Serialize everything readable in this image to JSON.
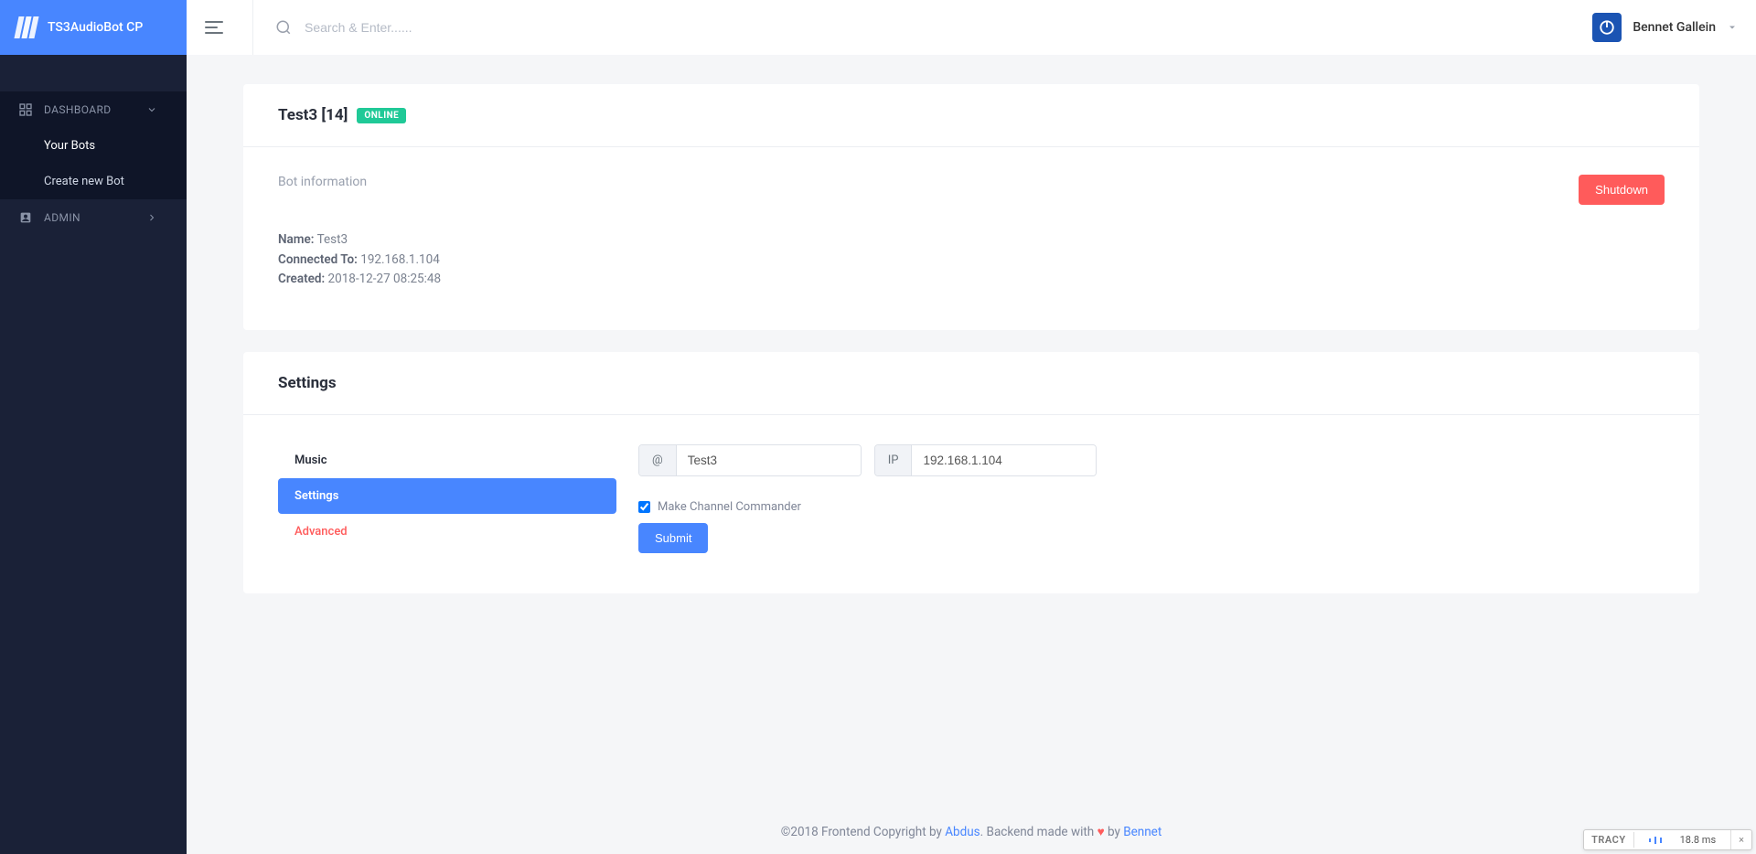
{
  "brand": {
    "title": "TS3AudioBot CP"
  },
  "search": {
    "placeholder": "Search & Enter......"
  },
  "user": {
    "name": "Bennet Gallein"
  },
  "sidebar": {
    "sections": [
      {
        "label": "DASHBOARD",
        "expanded": true,
        "items": [
          {
            "label": "Your Bots",
            "active": true
          },
          {
            "label": "Create new Bot",
            "active": false
          }
        ]
      },
      {
        "label": "ADMIN",
        "expanded": false,
        "items": []
      }
    ]
  },
  "bot": {
    "heading": "Test3 [14]",
    "status_badge": "ONLINE",
    "info_section_title": "Bot information",
    "shutdown_label": "Shutdown",
    "fields": {
      "name_label": "Name:",
      "name_value": "Test3",
      "connected_label": "Connected To:",
      "connected_value": "192.168.1.104",
      "created_label": "Created:",
      "created_value": "2018-12-27 08:25:48"
    }
  },
  "settings": {
    "title": "Settings",
    "tabs": [
      {
        "label": "Music",
        "type": "normal"
      },
      {
        "label": "Settings",
        "type": "active"
      },
      {
        "label": "Advanced",
        "type": "danger"
      }
    ],
    "inputs": {
      "name_prefix": "@",
      "name_value": "Test3",
      "ip_prefix": "IP",
      "ip_value": "192.168.1.104"
    },
    "checkbox_label": "Make Channel Commander",
    "checkbox_checked": true,
    "submit_label": "Submit"
  },
  "footer": {
    "part1": "©2018 Frontend Copyright by ",
    "link1": "Abdus",
    "part2": ". Backend made with ",
    "heart": "♥",
    "part3": " by ",
    "link2": "Bennet"
  },
  "tracy": {
    "label": "TRACY",
    "time": "18.8 ms",
    "close": "×"
  }
}
